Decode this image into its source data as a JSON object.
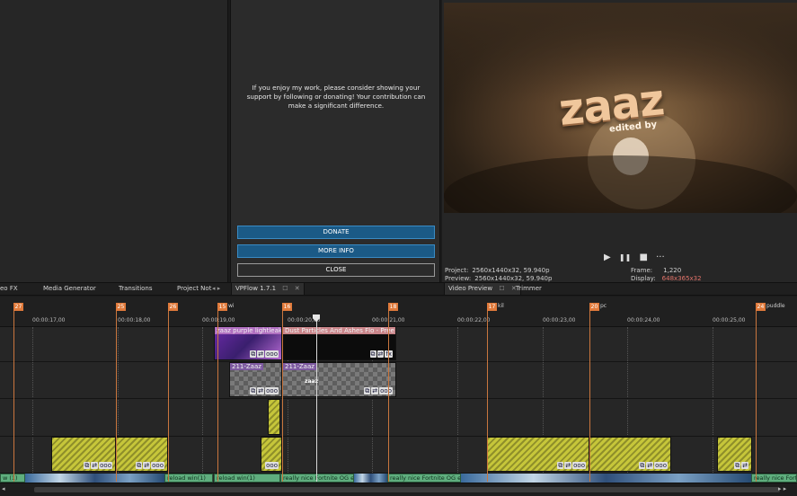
{
  "plugin": {
    "message": "If you enjoy my work, please consider showing your support by following or donating! Your contribution can make a significant difference.",
    "donate_label": "DONATE",
    "more_info_label": "MORE INFO",
    "close_label": "CLOSE"
  },
  "preview": {
    "overlay_title": "zaaz",
    "overlay_subtitle": "edited by",
    "transport": {
      "play": "▶",
      "pause": "❚❚",
      "stop": "■",
      "more": "···"
    },
    "project_label": "Project:",
    "project_value": "2560x1440x32, 59.940p",
    "preview_label": "Preview:",
    "preview_value": "2560x1440x32, 59.940p",
    "frame_label": "Frame:",
    "frame_value": "1,220",
    "display_label": "Display:",
    "display_value": "648x365x32"
  },
  "tabs": {
    "video_fx": "eo FX",
    "media_generator": "Media Generator",
    "transitions": "Transitions",
    "project_notes": "Project Not",
    "project_notes_arrow": "◂ ▸",
    "vpflow": "VPFlow 1.7.1",
    "video_preview": "Video Preview",
    "trimmer": "Trimmer",
    "close_x": "✕",
    "dock_icon": "☐"
  },
  "timeline": {
    "markers": [
      {
        "num": "27",
        "label": ""
      },
      {
        "num": "25",
        "label": ""
      },
      {
        "num": "26",
        "label": ""
      },
      {
        "num": "15",
        "label": "wi"
      },
      {
        "num": "16",
        "label": ""
      },
      {
        "num": "18",
        "label": ""
      },
      {
        "num": "17",
        "label": "kil"
      },
      {
        "num": "20",
        "label": "pc"
      },
      {
        "num": "24",
        "label": "puddle"
      }
    ],
    "ticks": [
      "00:00:17,00",
      "00:00:18,00",
      "00:00:19,00",
      "00:00:20,00",
      "00:00:21,00",
      "00:00:22,00",
      "00:00:23,00",
      "00:00:24,00",
      "00:00:25,00"
    ],
    "clips": {
      "lightleak": "zaaz purple lightleak usa",
      "dust": "Dust Particles And Ashes Flo",
      "dust_more": "- Pree",
      "zaaz_a": "211-Zaaz",
      "zaaz_b": "211-Zaaz",
      "zaaz_c": "zaaz"
    },
    "audio": {
      "a1": "w (1)",
      "a2": "reload win(1)",
      "a3": "reload win(1)",
      "a4": "really nice Fortnite OG ec",
      "a5": "really nice Fortnite OG ec",
      "a6": "really nice Fortnite OG"
    },
    "fx_badge": "fx",
    "fx_icons": [
      "⧉",
      "⇄",
      "ooo"
    ]
  },
  "scroll": {
    "left": "◂",
    "right": "▸ ▸"
  }
}
